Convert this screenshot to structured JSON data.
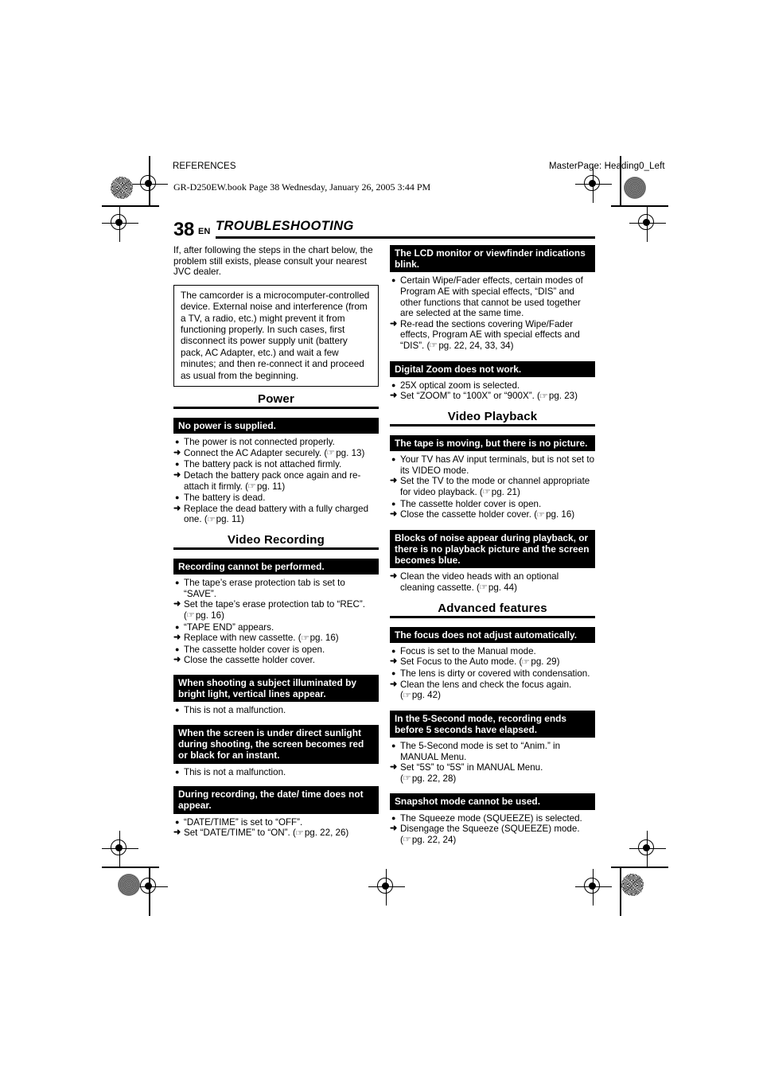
{
  "print_marks": {
    "header_left": "REFERENCES",
    "header_right": "MasterPage: Heading0_Left",
    "book_line": "GR-D250EW.book  Page 38  Wednesday, January 26, 2005  3:44 PM"
  },
  "page": {
    "number": "38",
    "lang": "EN",
    "title": "TROUBLESHOOTING"
  },
  "left_column": {
    "intro": "If, after following the steps in the chart below, the problem still exists, please consult your nearest JVC dealer.",
    "note": "The camcorder is a microcomputer-controlled device. External noise and interference (from a TV, a radio, etc.) might prevent it from functioning properly. In such cases, first disconnect its power supply unit (battery pack, AC Adapter, etc.) and wait a few minutes; and then re-connect it and proceed as usual from the beginning.",
    "sections": [
      {
        "heading": "Power",
        "blocks": [
          {
            "symptom": "No power is supplied.",
            "items": [
              {
                "type": "cause",
                "text": "The power is not connected properly."
              },
              {
                "type": "action",
                "text": "Connect the AC Adapter securely.",
                "pgref": "pg. 13"
              },
              {
                "type": "cause",
                "text": "The battery pack is not attached firmly."
              },
              {
                "type": "action",
                "text": "Detach the battery pack once again and re-attach it firmly.",
                "pgref": "pg. 11"
              },
              {
                "type": "cause",
                "text": "The battery is dead."
              },
              {
                "type": "action",
                "text": "Replace the dead battery with a fully charged one.",
                "pgref": "pg. 11"
              }
            ]
          }
        ]
      },
      {
        "heading": "Video Recording",
        "blocks": [
          {
            "symptom": "Recording cannot be performed.",
            "items": [
              {
                "type": "cause",
                "text": "The tape’s erase protection tab is set to “SAVE”."
              },
              {
                "type": "action",
                "text": "Set the tape’s erase protection tab to “REC”.",
                "pgref": "pg. 16",
                "pgref_newline": true
              },
              {
                "type": "cause",
                "text": "“TAPE END” appears."
              },
              {
                "type": "action",
                "text": "Replace with new cassette.",
                "pgref": "pg. 16"
              },
              {
                "type": "cause",
                "text": "The cassette holder cover is open."
              },
              {
                "type": "action",
                "text": "Close the cassette holder cover."
              }
            ]
          },
          {
            "symptom": "When shooting a subject illuminated by bright light, vertical lines appear.",
            "items": [
              {
                "type": "cause",
                "text": "This is not a malfunction."
              }
            ]
          },
          {
            "symptom": "When the screen is under direct sunlight during shooting, the screen becomes red or black for an instant.",
            "items": [
              {
                "type": "cause",
                "text": "This is not a malfunction."
              }
            ]
          },
          {
            "symptom": "During recording, the date/ time does not appear.",
            "items": [
              {
                "type": "cause",
                "text": "“DATE/TIME” is set to “OFF”."
              },
              {
                "type": "action",
                "text": "Set “DATE/TIME” to “ON”.",
                "pgref": "pg. 22, 26"
              }
            ]
          }
        ]
      }
    ]
  },
  "right_column": {
    "sections": [
      {
        "heading": null,
        "blocks": [
          {
            "symptom": "The LCD monitor or viewfinder indications blink.",
            "items": [
              {
                "type": "cause",
                "text": "Certain Wipe/Fader effects, certain modes of Program AE with special effects, “DIS” and other functions that cannot be used together are selected at the same time."
              },
              {
                "type": "action",
                "text": "Re-read the sections covering Wipe/Fader effects, Program AE with special effects and “DIS”.",
                "pgref": "pg. 22, 24, 33, 34"
              }
            ]
          },
          {
            "symptom": "Digital Zoom does not work.",
            "items": [
              {
                "type": "cause",
                "text": "25X optical zoom is selected."
              },
              {
                "type": "action",
                "text": "Set “ZOOM” to “100X” or “900X”.",
                "pgref": "pg. 23"
              }
            ]
          }
        ]
      },
      {
        "heading": "Video Playback",
        "blocks": [
          {
            "symptom": "The tape is moving, but there is no picture.",
            "items": [
              {
                "type": "cause",
                "text": "Your TV has AV input terminals, but is not set to its VIDEO mode."
              },
              {
                "type": "action",
                "text": "Set the TV to the mode or channel appropriate for video playback.",
                "pgref": "pg. 21"
              },
              {
                "type": "cause",
                "text": "The cassette holder cover is open."
              },
              {
                "type": "action",
                "text": "Close the cassette holder cover.",
                "pgref": "pg. 16"
              }
            ]
          },
          {
            "symptom": "Blocks of noise appear during playback, or there is no playback picture and the screen becomes blue.",
            "items": [
              {
                "type": "action",
                "text": "Clean the video heads with an optional cleaning cassette.",
                "pgref": "pg. 44"
              }
            ]
          }
        ]
      },
      {
        "heading": "Advanced features",
        "blocks": [
          {
            "symptom": "The focus does not adjust automatically.",
            "items": [
              {
                "type": "cause",
                "text": "Focus is set to the Manual mode."
              },
              {
                "type": "action",
                "text": "Set Focus to the Auto mode.",
                "pgref": "pg. 29"
              },
              {
                "type": "cause",
                "text": "The lens is dirty or covered with condensation."
              },
              {
                "type": "action",
                "text": "Clean the lens and check the focus again.",
                "pgref": "pg. 42",
                "pgref_newline": true
              }
            ]
          },
          {
            "symptom": "In the 5-Second mode, recording ends before 5 seconds have elapsed.",
            "items": [
              {
                "type": "cause",
                "text": "The 5-Second mode is set to “Anim.” in MANUAL Menu."
              },
              {
                "type": "action",
                "text": "Set “5S” to “5S” in MANUAL Menu.",
                "pgref": "pg. 22, 28",
                "pgref_newline": true
              }
            ]
          },
          {
            "symptom": "Snapshot mode cannot be used.",
            "items": [
              {
                "type": "cause",
                "text": "The Squeeze mode (SQUEEZE) is selected."
              },
              {
                "type": "action",
                "text": "Disengage the Squeeze (SQUEEZE) mode.",
                "pgref": "pg. 22, 24",
                "pgref_newline": true
              }
            ]
          }
        ]
      }
    ]
  },
  "glyphs": {
    "cause_bullet": "●",
    "action_arrow": "➜",
    "page_hand": "☞"
  }
}
